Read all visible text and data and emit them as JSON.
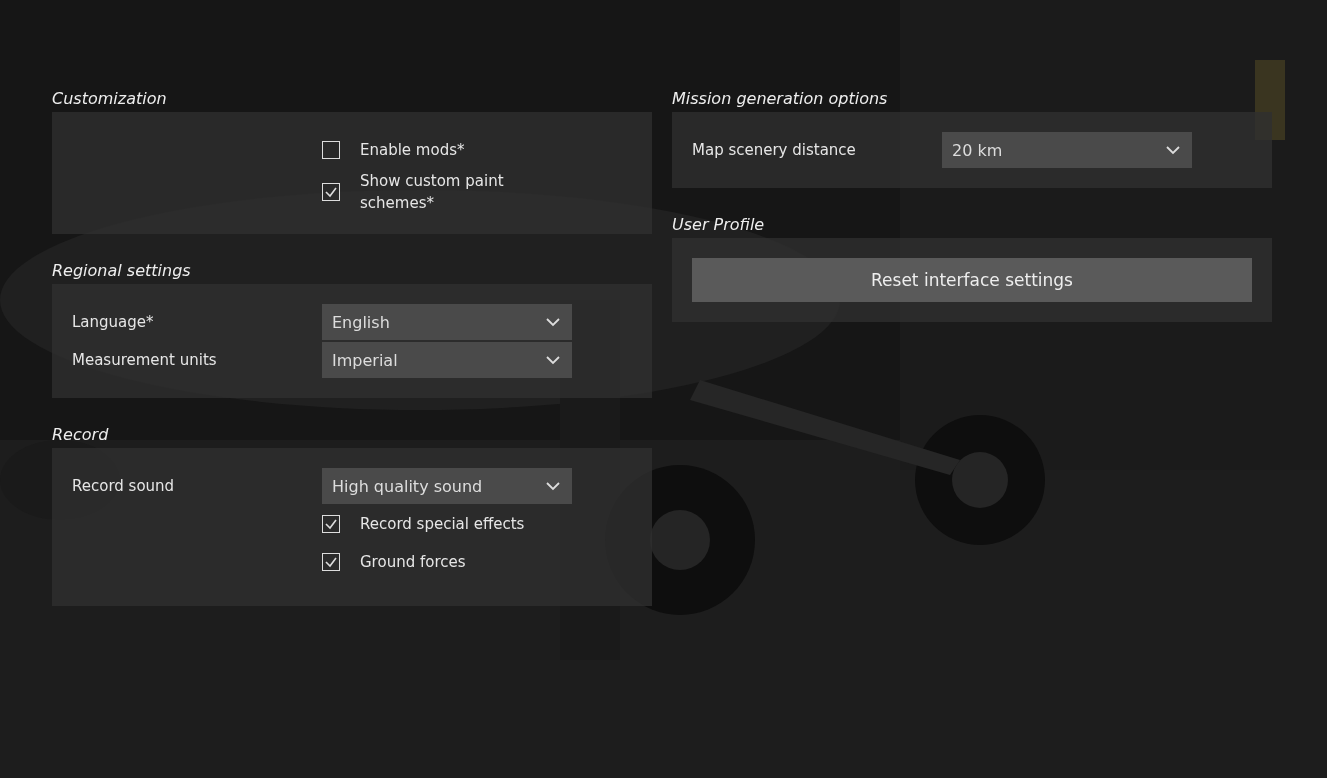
{
  "columns": [
    {
      "sections": [
        {
          "title": "Customization",
          "rows": [
            {
              "kind": "checkbox",
              "label": "Enable mods*",
              "checked": false
            },
            {
              "kind": "checkbox",
              "label": "Show custom paint schemes*",
              "checked": true
            }
          ]
        },
        {
          "title": "Regional settings",
          "rows": [
            {
              "kind": "dropdown",
              "label": "Language*",
              "value": "English"
            },
            {
              "kind": "dropdown",
              "label": "Measurement units",
              "value": "Imperial"
            }
          ]
        },
        {
          "title": "Record",
          "rows": [
            {
              "kind": "dropdown",
              "label": "Record sound",
              "value": "High quality sound"
            },
            {
              "kind": "checkbox",
              "label": "Record special effects",
              "checked": true
            },
            {
              "kind": "checkbox",
              "label": "Ground forces",
              "checked": true
            }
          ]
        }
      ]
    },
    {
      "sections": [
        {
          "title": "Mission generation options",
          "rows": [
            {
              "kind": "dropdown",
              "label": "Map scenery distance",
              "value": "20 km"
            }
          ]
        },
        {
          "title": "User Profile",
          "rows": [
            {
              "kind": "button",
              "label": "Reset interface settings"
            }
          ]
        }
      ]
    }
  ]
}
